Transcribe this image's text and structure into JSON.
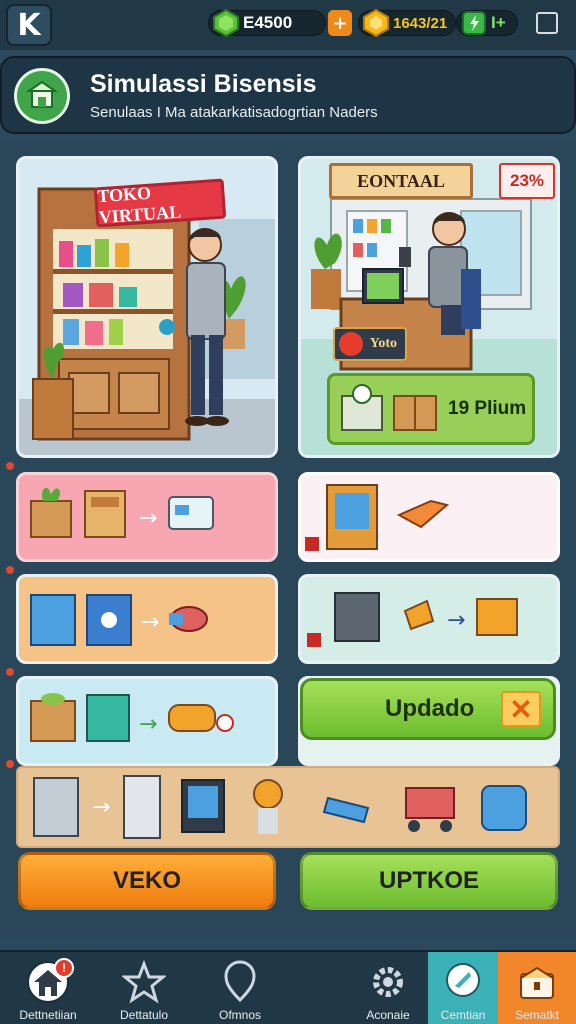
{
  "topbar": {
    "back_label": "K",
    "coins": "E4500",
    "coins_plus": "+",
    "gems": "1643/21",
    "energy": "I+",
    "colors": {
      "coin": "#5ac23a",
      "gem": "#f6b91a",
      "energy": "#3db64b"
    }
  },
  "header": {
    "title": "Simulassi Bisensis",
    "subtitle": "Senulaas I Ma atakarkatisadogrtian Naders"
  },
  "scenes": {
    "left_sign": "TOKO VIRTUAL",
    "right_sign": "EONTAAL",
    "right_percent": "23%",
    "badge_text": "Yoto",
    "plan_text": "19 Plium"
  },
  "actions": {
    "update_label": "Updado",
    "left_button": "VEKO",
    "right_button": "UPTKOE"
  },
  "nav": {
    "items": [
      {
        "label": "Dettnetiian",
        "icon": "home-icon",
        "badge": "!"
      },
      {
        "label": "Dettatulo",
        "icon": "star-icon"
      },
      {
        "label": "Ofmnos",
        "icon": "shield-icon"
      },
      {
        "label": "Aconaie",
        "icon": "gear-icon"
      },
      {
        "label": "Cemtian",
        "icon": "chat-icon"
      },
      {
        "label": "Sematkt",
        "icon": "chest-icon"
      }
    ]
  }
}
